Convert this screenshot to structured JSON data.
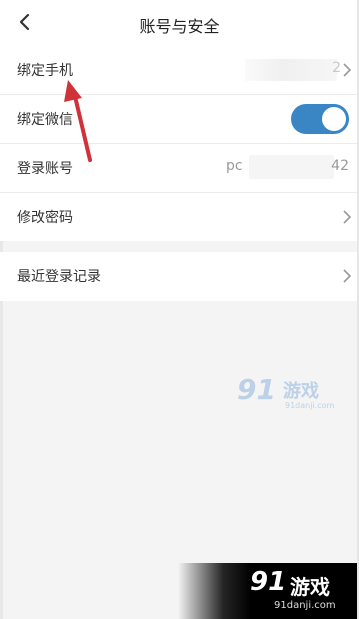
{
  "header": {
    "title": "账号与安全",
    "back_icon": "chevron-left-icon"
  },
  "rows": {
    "bind_phone": {
      "label": "绑定手机",
      "value_tail": "2"
    },
    "bind_wechat": {
      "label": "绑定微信",
      "toggle_on": true
    },
    "login_account": {
      "label": "登录账号",
      "value_prefix": "pc",
      "value_suffix": "42"
    },
    "change_password": {
      "label": "修改密码"
    },
    "recent_login": {
      "label": "最近登录记录"
    }
  },
  "colors": {
    "toggle_on": "#3a86c4",
    "annotation_arrow": "#d0323a",
    "watermark": "#7aa7d8"
  },
  "watermark": {
    "center_logo": "91",
    "center_text": "游戏",
    "center_url": "91danji.com",
    "corner_logo": "91",
    "corner_text": "游戏",
    "corner_url": "91danji.com"
  }
}
